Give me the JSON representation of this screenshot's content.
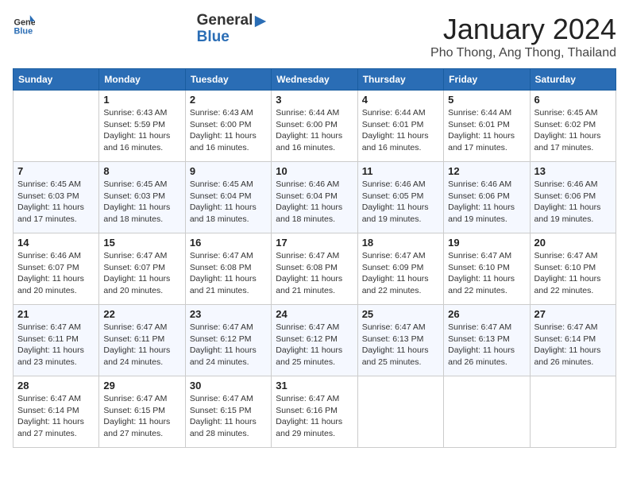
{
  "logo": {
    "general": "General",
    "blue": "Blue"
  },
  "header": {
    "month": "January 2024",
    "location": "Pho Thong, Ang Thong, Thailand"
  },
  "weekdays": [
    "Sunday",
    "Monday",
    "Tuesday",
    "Wednesday",
    "Thursday",
    "Friday",
    "Saturday"
  ],
  "weeks": [
    [
      {
        "day": "",
        "sunrise": "",
        "sunset": "",
        "daylight": ""
      },
      {
        "day": "1",
        "sunrise": "Sunrise: 6:43 AM",
        "sunset": "Sunset: 5:59 PM",
        "daylight": "Daylight: 11 hours and 16 minutes."
      },
      {
        "day": "2",
        "sunrise": "Sunrise: 6:43 AM",
        "sunset": "Sunset: 6:00 PM",
        "daylight": "Daylight: 11 hours and 16 minutes."
      },
      {
        "day": "3",
        "sunrise": "Sunrise: 6:44 AM",
        "sunset": "Sunset: 6:00 PM",
        "daylight": "Daylight: 11 hours and 16 minutes."
      },
      {
        "day": "4",
        "sunrise": "Sunrise: 6:44 AM",
        "sunset": "Sunset: 6:01 PM",
        "daylight": "Daylight: 11 hours and 16 minutes."
      },
      {
        "day": "5",
        "sunrise": "Sunrise: 6:44 AM",
        "sunset": "Sunset: 6:01 PM",
        "daylight": "Daylight: 11 hours and 17 minutes."
      },
      {
        "day": "6",
        "sunrise": "Sunrise: 6:45 AM",
        "sunset": "Sunset: 6:02 PM",
        "daylight": "Daylight: 11 hours and 17 minutes."
      }
    ],
    [
      {
        "day": "7",
        "sunrise": "Sunrise: 6:45 AM",
        "sunset": "Sunset: 6:03 PM",
        "daylight": "Daylight: 11 hours and 17 minutes."
      },
      {
        "day": "8",
        "sunrise": "Sunrise: 6:45 AM",
        "sunset": "Sunset: 6:03 PM",
        "daylight": "Daylight: 11 hours and 18 minutes."
      },
      {
        "day": "9",
        "sunrise": "Sunrise: 6:45 AM",
        "sunset": "Sunset: 6:04 PM",
        "daylight": "Daylight: 11 hours and 18 minutes."
      },
      {
        "day": "10",
        "sunrise": "Sunrise: 6:46 AM",
        "sunset": "Sunset: 6:04 PM",
        "daylight": "Daylight: 11 hours and 18 minutes."
      },
      {
        "day": "11",
        "sunrise": "Sunrise: 6:46 AM",
        "sunset": "Sunset: 6:05 PM",
        "daylight": "Daylight: 11 hours and 19 minutes."
      },
      {
        "day": "12",
        "sunrise": "Sunrise: 6:46 AM",
        "sunset": "Sunset: 6:06 PM",
        "daylight": "Daylight: 11 hours and 19 minutes."
      },
      {
        "day": "13",
        "sunrise": "Sunrise: 6:46 AM",
        "sunset": "Sunset: 6:06 PM",
        "daylight": "Daylight: 11 hours and 19 minutes."
      }
    ],
    [
      {
        "day": "14",
        "sunrise": "Sunrise: 6:46 AM",
        "sunset": "Sunset: 6:07 PM",
        "daylight": "Daylight: 11 hours and 20 minutes."
      },
      {
        "day": "15",
        "sunrise": "Sunrise: 6:47 AM",
        "sunset": "Sunset: 6:07 PM",
        "daylight": "Daylight: 11 hours and 20 minutes."
      },
      {
        "day": "16",
        "sunrise": "Sunrise: 6:47 AM",
        "sunset": "Sunset: 6:08 PM",
        "daylight": "Daylight: 11 hours and 21 minutes."
      },
      {
        "day": "17",
        "sunrise": "Sunrise: 6:47 AM",
        "sunset": "Sunset: 6:08 PM",
        "daylight": "Daylight: 11 hours and 21 minutes."
      },
      {
        "day": "18",
        "sunrise": "Sunrise: 6:47 AM",
        "sunset": "Sunset: 6:09 PM",
        "daylight": "Daylight: 11 hours and 22 minutes."
      },
      {
        "day": "19",
        "sunrise": "Sunrise: 6:47 AM",
        "sunset": "Sunset: 6:10 PM",
        "daylight": "Daylight: 11 hours and 22 minutes."
      },
      {
        "day": "20",
        "sunrise": "Sunrise: 6:47 AM",
        "sunset": "Sunset: 6:10 PM",
        "daylight": "Daylight: 11 hours and 22 minutes."
      }
    ],
    [
      {
        "day": "21",
        "sunrise": "Sunrise: 6:47 AM",
        "sunset": "Sunset: 6:11 PM",
        "daylight": "Daylight: 11 hours and 23 minutes."
      },
      {
        "day": "22",
        "sunrise": "Sunrise: 6:47 AM",
        "sunset": "Sunset: 6:11 PM",
        "daylight": "Daylight: 11 hours and 24 minutes."
      },
      {
        "day": "23",
        "sunrise": "Sunrise: 6:47 AM",
        "sunset": "Sunset: 6:12 PM",
        "daylight": "Daylight: 11 hours and 24 minutes."
      },
      {
        "day": "24",
        "sunrise": "Sunrise: 6:47 AM",
        "sunset": "Sunset: 6:12 PM",
        "daylight": "Daylight: 11 hours and 25 minutes."
      },
      {
        "day": "25",
        "sunrise": "Sunrise: 6:47 AM",
        "sunset": "Sunset: 6:13 PM",
        "daylight": "Daylight: 11 hours and 25 minutes."
      },
      {
        "day": "26",
        "sunrise": "Sunrise: 6:47 AM",
        "sunset": "Sunset: 6:13 PM",
        "daylight": "Daylight: 11 hours and 26 minutes."
      },
      {
        "day": "27",
        "sunrise": "Sunrise: 6:47 AM",
        "sunset": "Sunset: 6:14 PM",
        "daylight": "Daylight: 11 hours and 26 minutes."
      }
    ],
    [
      {
        "day": "28",
        "sunrise": "Sunrise: 6:47 AM",
        "sunset": "Sunset: 6:14 PM",
        "daylight": "Daylight: 11 hours and 27 minutes."
      },
      {
        "day": "29",
        "sunrise": "Sunrise: 6:47 AM",
        "sunset": "Sunset: 6:15 PM",
        "daylight": "Daylight: 11 hours and 27 minutes."
      },
      {
        "day": "30",
        "sunrise": "Sunrise: 6:47 AM",
        "sunset": "Sunset: 6:15 PM",
        "daylight": "Daylight: 11 hours and 28 minutes."
      },
      {
        "day": "31",
        "sunrise": "Sunrise: 6:47 AM",
        "sunset": "Sunset: 6:16 PM",
        "daylight": "Daylight: 11 hours and 29 minutes."
      },
      {
        "day": "",
        "sunrise": "",
        "sunset": "",
        "daylight": ""
      },
      {
        "day": "",
        "sunrise": "",
        "sunset": "",
        "daylight": ""
      },
      {
        "day": "",
        "sunrise": "",
        "sunset": "",
        "daylight": ""
      }
    ]
  ]
}
